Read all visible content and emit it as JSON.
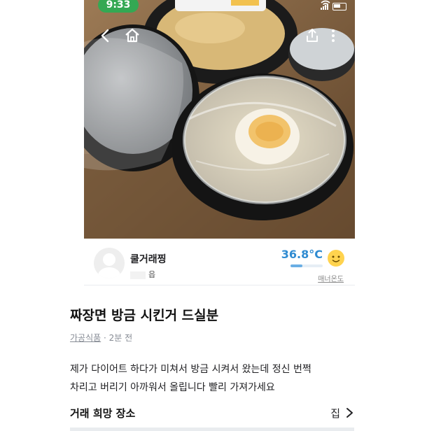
{
  "status_bar": {
    "time": "9:33"
  },
  "photo": {
    "alt": ""
  },
  "seller": {
    "nickname": "쿨거래찡",
    "region": "읍",
    "manner_temp": "36.8°C",
    "manner_label": "매너온도",
    "manner_level_pct": 37
  },
  "post": {
    "title": "짜장면 방금 시킨거 드실분",
    "category": "가공식품",
    "time_ago": "2분 전",
    "body_line1": "제가 다이어트 하다가 미쳐서 방금 시켜서 왔는데 정신 번쩍",
    "body_line2": "차리고 버리기 아까워서 올립니다 빨리 가져가세요"
  },
  "trade_place": {
    "label": "거래 희망 장소",
    "value": "집"
  },
  "colors": {
    "status_pill": "#34a853",
    "temp_text": "#2f8bd1",
    "temp_fill": "#6aaee4"
  }
}
